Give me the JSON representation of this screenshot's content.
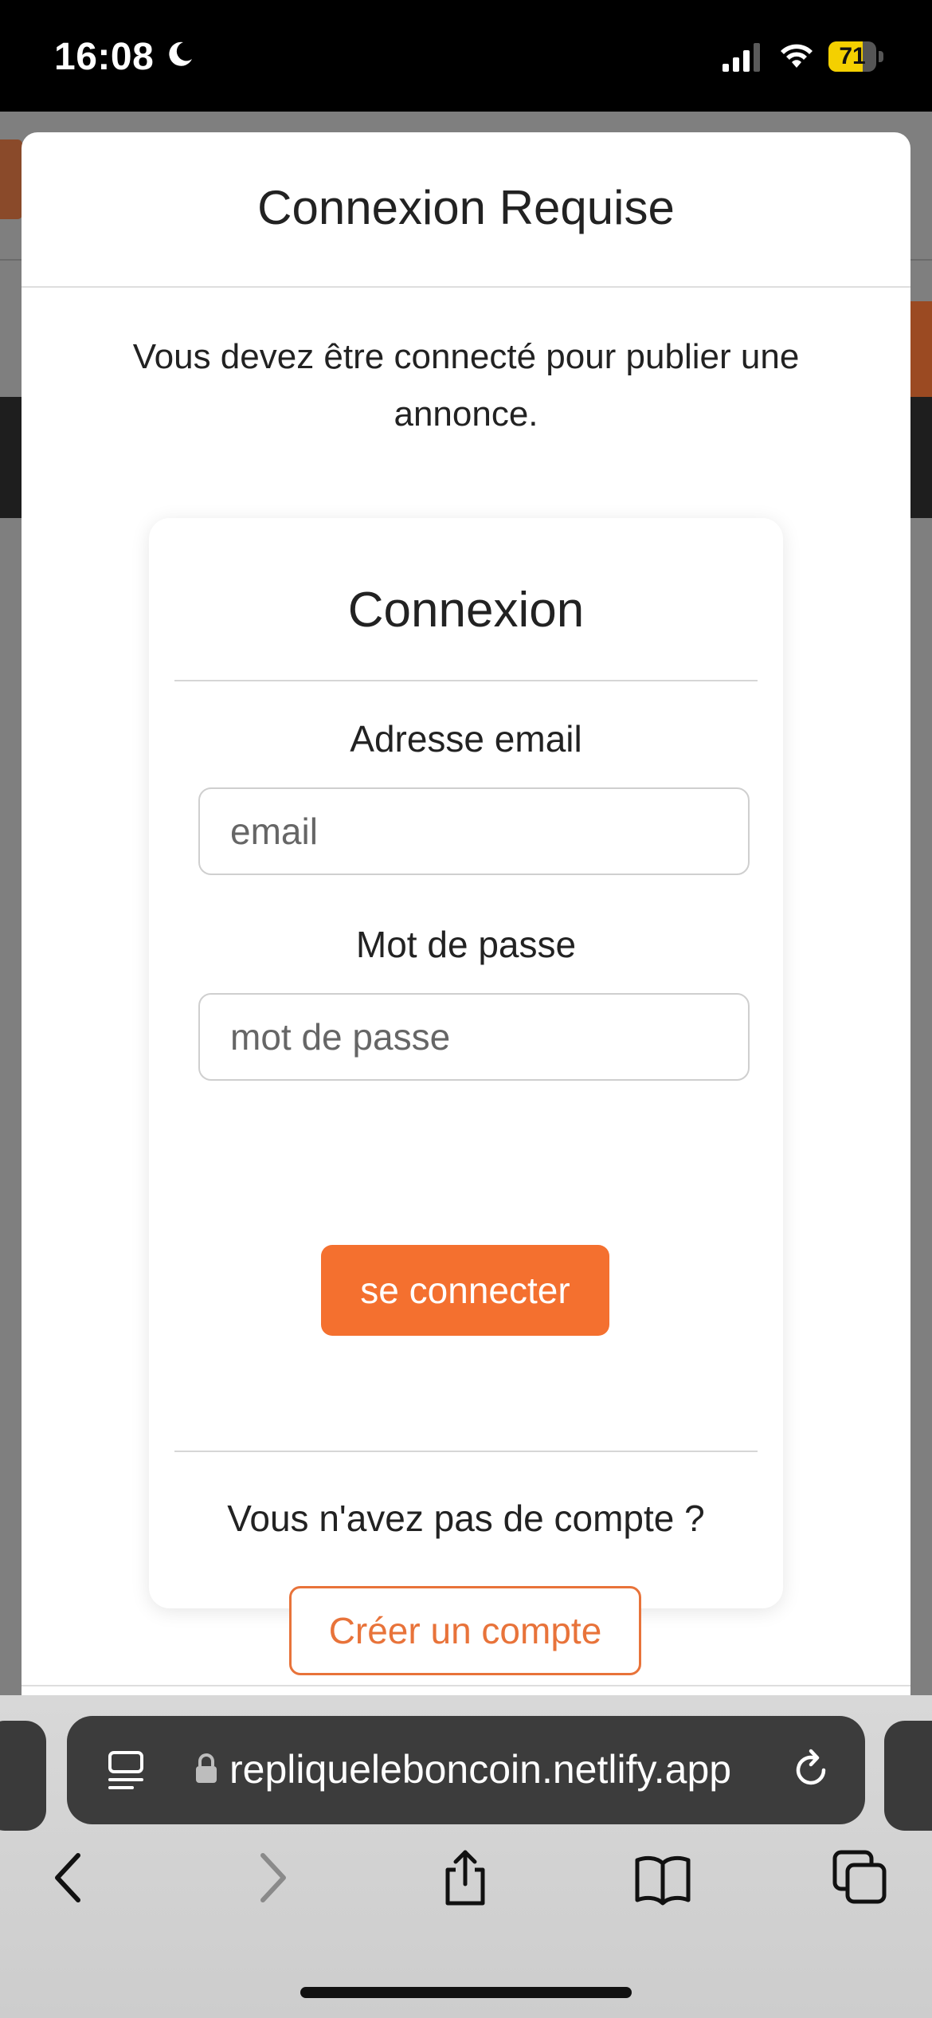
{
  "status_bar": {
    "time": "16:08",
    "battery_level": "71",
    "battery_fraction": 0.71,
    "icons": [
      "moon-icon",
      "signal-icon",
      "wifi-icon",
      "battery-icon"
    ]
  },
  "modal": {
    "title": "Connexion Requise",
    "message": "Vous devez être connecté pour publier une annonce."
  },
  "login": {
    "title": "Connexion",
    "email_label": "Adresse email",
    "email_placeholder": "email",
    "password_label": "Mot de passe",
    "password_placeholder": "mot de passe",
    "submit_label": "se connecter",
    "no_account_text": "Vous n'avez pas de compte ?",
    "signup_label": "Créer un compte"
  },
  "browser": {
    "url": "repliqueleboncoin.netlify.app",
    "toolbar_icons": [
      "back-icon",
      "forward-icon",
      "share-icon",
      "bookmarks-icon",
      "tabs-icon"
    ]
  },
  "colors": {
    "accent": "#f4702f",
    "signup_border": "#e8733a",
    "battery": "#f4d000"
  }
}
